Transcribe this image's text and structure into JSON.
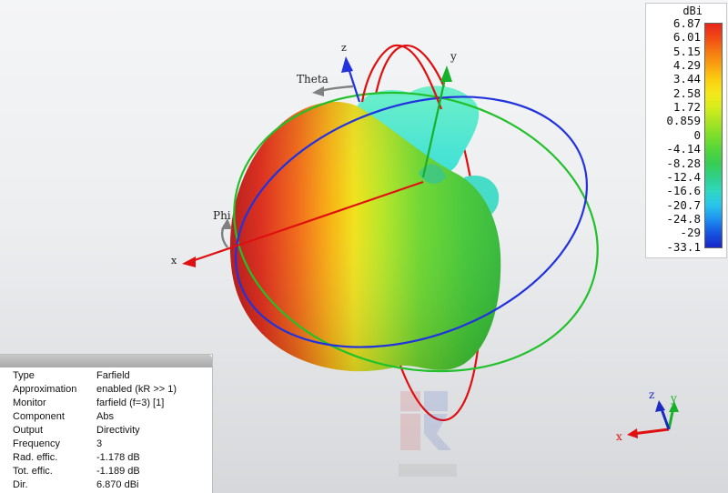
{
  "legend": {
    "unit": "dBi",
    "ticks": [
      "6.87",
      "6.01",
      "5.15",
      "4.29",
      "3.44",
      "2.58",
      "1.72",
      "0.859",
      "0",
      "-4.14",
      "-8.28",
      "-12.4",
      "-16.6",
      "-20.7",
      "-24.8",
      "-29",
      "-33.1"
    ],
    "colors": [
      "#e8251a",
      "#f04a15",
      "#f57a12",
      "#f9a30f",
      "#fbcf11",
      "#f4e81a",
      "#d6ec1d",
      "#aae324",
      "#7ede2a",
      "#54d63a",
      "#39cc55",
      "#2fd08a",
      "#2fd8c2",
      "#29c4ec",
      "#1e8ff0",
      "#1652e0",
      "#1a25c8"
    ]
  },
  "axes": {
    "x": "x",
    "y": "y",
    "z": "z",
    "theta": "Theta",
    "phi": "Phi"
  },
  "info": {
    "rows": [
      {
        "key": "Type",
        "value": "Farfield"
      },
      {
        "key": "Approximation",
        "value": "enabled (kR >> 1)"
      },
      {
        "key": "Monitor",
        "value": "farfield (f=3) [1]"
      },
      {
        "key": "Component",
        "value": "Abs"
      },
      {
        "key": "Output",
        "value": "Directivity"
      },
      {
        "key": "Frequency",
        "value": "3"
      },
      {
        "key": "Rad. effic.",
        "value": "-1.178 dB"
      },
      {
        "key": "Tot. effic.",
        "value": "-1.189 dB"
      },
      {
        "key": "Dir.",
        "value": "6.870 dBi"
      }
    ]
  },
  "mini_axes": {
    "x": "x",
    "y": "y",
    "z": "z"
  },
  "colors": {
    "x_axis": "#e01010",
    "y_axis": "#16b02a",
    "z_axis": "#2233dd",
    "ring_red": "#e01010",
    "ring_green": "#22c02a",
    "ring_blue": "#2233dd"
  }
}
